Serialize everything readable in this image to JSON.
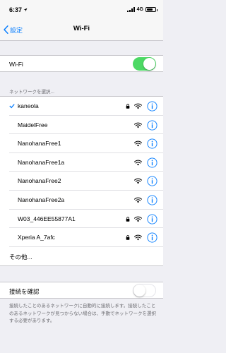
{
  "status": {
    "time": "6:37",
    "network": "4G"
  },
  "nav": {
    "back_label": "設定",
    "title": "Wi-Fi"
  },
  "wifi_toggle": {
    "label": "Wi-Fi",
    "on": true,
    "color": "#4cd964"
  },
  "section_header": "ネットワークを選択...",
  "networks": [
    {
      "name": "kaneola",
      "locked": true,
      "selected": true
    },
    {
      "name": "MaidelFree",
      "locked": false
    },
    {
      "name": "NanohanaFree1",
      "locked": false
    },
    {
      "name": "NanohanaFree1a",
      "locked": false
    },
    {
      "name": "NanohanaFree2",
      "locked": false
    },
    {
      "name": "NanohanaFree2a",
      "locked": false
    },
    {
      "name": "W03_446EE55877A1",
      "locked": true
    },
    {
      "name": "Xperia A_7afc",
      "locked": true
    },
    {
      "name": "その他...",
      "other": true
    }
  ],
  "ask_to_join": {
    "label": "接続を確認",
    "on": false
  },
  "footer": "接続したことのあるネットワークに自動的に接続します。接続したことのあるネットワークが見つからない場合は、手動でネットワークを選択する必要があります。",
  "colors": {
    "accent": "#007aff",
    "background": "#efeff4"
  }
}
